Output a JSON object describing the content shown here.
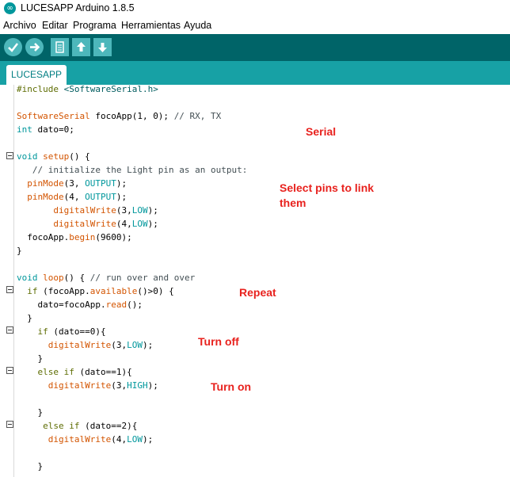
{
  "window": {
    "title": "LUCESAPP Arduino 1.8.5",
    "app_icon": "arduino-infinity-icon"
  },
  "menu": [
    "Archivo",
    "Editar",
    "Programa",
    "Herramientas",
    "Ayuda"
  ],
  "toolbar": {
    "buttons": [
      {
        "name": "verify",
        "icon": "checkmark-icon"
      },
      {
        "name": "upload",
        "icon": "arrow-right-icon"
      },
      {
        "name": "new",
        "icon": "new-file-icon"
      },
      {
        "name": "open",
        "icon": "arrow-up-icon"
      },
      {
        "name": "save",
        "icon": "arrow-down-icon"
      }
    ]
  },
  "tabs": [
    {
      "label": "LUCESAPP"
    }
  ],
  "code": {
    "l0": {
      "a": "#include ",
      "b": "<SoftwareSerial.h>"
    },
    "l1": {
      "a": "SoftwareSerial",
      "b": " focoApp(1, 0); ",
      "c": "// RX, TX"
    },
    "l2": {
      "a": "int",
      "b": " dato=0;"
    },
    "l3": {
      "a": "void",
      "b": " setup",
      "c": "() {"
    },
    "l4": {
      "a": "   // initialize the Light pin as an output:"
    },
    "l5": {
      "a": "  pinMode",
      "b": "(3, ",
      "c": "OUTPUT",
      "d": ");"
    },
    "l6": {
      "a": "  pinMode",
      "b": "(4, ",
      "c": "OUTPUT",
      "d": ");"
    },
    "l7": {
      "a": "       digitalWrite",
      "b": "(3,",
      "c": "LOW",
      "d": ");"
    },
    "l8": {
      "a": "       digitalWrite",
      "b": "(4,",
      "c": "LOW",
      "d": ");"
    },
    "l9": {
      "a": "  focoApp.",
      "b": "begin",
      "c": "(9600);"
    },
    "l10": {
      "a": "}"
    },
    "l11": {
      "a": "void",
      "b": " loop",
      "c": "() { ",
      "d": "// run over and over"
    },
    "l12": {
      "a": "  if",
      "b": " (focoApp.",
      "c": "available",
      "d": "()>0) {"
    },
    "l13": {
      "a": "    dato=focoApp.",
      "b": "read",
      "c": "();"
    },
    "l14": {
      "a": "  }"
    },
    "l15": {
      "a": "    if",
      "b": " (dato==0){"
    },
    "l16": {
      "a": "      digitalWrite",
      "b": "(3,",
      "c": "LOW",
      "d": ");"
    },
    "l17": {
      "a": "    }"
    },
    "l18": {
      "a": "    else",
      "b": " if",
      "c": " (dato==1){"
    },
    "l19": {
      "a": "      digitalWrite",
      "b": "(3,",
      "c": "HIGH",
      "d": ");"
    },
    "l20": {
      "a": "    }"
    },
    "l21": {
      "a": "     else",
      "b": " if",
      "c": " (dato==2){"
    },
    "l22": {
      "a": "      digitalWrite",
      "b": "(4,",
      "c": "LOW",
      "d": ");"
    },
    "l23": {
      "a": "    }"
    }
  },
  "annotations": {
    "serial": "Serial",
    "select_pins_1": "Select pins to link",
    "select_pins_2": "them",
    "repeat": "Repeat",
    "turn_off": "Turn off",
    "turn_on": "Turn on"
  },
  "colors": {
    "toolbar": "#006468",
    "tabbar": "#17a1a5",
    "button": "#4db7bb",
    "keyword": "#00979c",
    "function": "#d35400",
    "annotation": "#e8221e"
  }
}
